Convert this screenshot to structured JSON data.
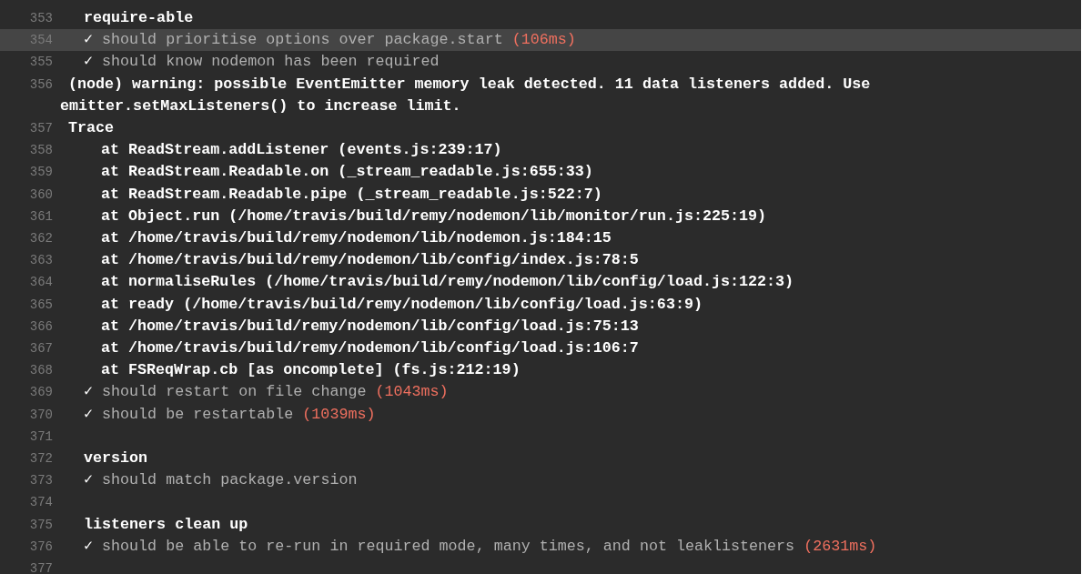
{
  "log": {
    "lines": [
      {
        "number": "353",
        "kind": "heading",
        "text": "require-able",
        "selected": false
      },
      {
        "number": "354",
        "kind": "pass",
        "mark": "✓",
        "text": "should prioritise options over package.start",
        "duration": "(106ms)",
        "selected": true
      },
      {
        "number": "355",
        "kind": "pass",
        "mark": "✓",
        "text": "should know nodemon has been required",
        "selected": false
      },
      {
        "number": "356",
        "kind": "output",
        "text": "(node) warning: possible EventEmitter memory leak detected. 11 data listeners added. Use emitter.setMaxListeners() to increase limit.",
        "selected": false
      },
      {
        "number": "357",
        "kind": "output",
        "text": "Trace",
        "selected": false
      },
      {
        "number": "358",
        "kind": "stack",
        "text": "at ReadStream.addListener (events.js:239:17)",
        "selected": false
      },
      {
        "number": "359",
        "kind": "stack",
        "text": "at ReadStream.Readable.on (_stream_readable.js:655:33)",
        "selected": false
      },
      {
        "number": "360",
        "kind": "stack",
        "text": "at ReadStream.Readable.pipe (_stream_readable.js:522:7)",
        "selected": false
      },
      {
        "number": "361",
        "kind": "stack",
        "text": "at Object.run (/home/travis/build/remy/nodemon/lib/monitor/run.js:225:19)",
        "selected": false
      },
      {
        "number": "362",
        "kind": "stack",
        "text": "at /home/travis/build/remy/nodemon/lib/nodemon.js:184:15",
        "selected": false
      },
      {
        "number": "363",
        "kind": "stack",
        "text": "at /home/travis/build/remy/nodemon/lib/config/index.js:78:5",
        "selected": false
      },
      {
        "number": "364",
        "kind": "stack",
        "text": "at normaliseRules (/home/travis/build/remy/nodemon/lib/config/load.js:122:3)",
        "selected": false
      },
      {
        "number": "365",
        "kind": "stack",
        "text": "at ready (/home/travis/build/remy/nodemon/lib/config/load.js:63:9)",
        "selected": false
      },
      {
        "number": "366",
        "kind": "stack",
        "text": "at /home/travis/build/remy/nodemon/lib/config/load.js:75:13",
        "selected": false
      },
      {
        "number": "367",
        "kind": "stack",
        "text": "at /home/travis/build/remy/nodemon/lib/config/load.js:106:7",
        "selected": false
      },
      {
        "number": "368",
        "kind": "stack",
        "text": "at FSReqWrap.cb [as oncomplete] (fs.js:212:19)",
        "selected": false
      },
      {
        "number": "369",
        "kind": "pass",
        "mark": "✓",
        "text": "should restart on file change",
        "duration": "(1043ms)",
        "selected": false
      },
      {
        "number": "370",
        "kind": "pass",
        "mark": "✓",
        "text": "should be restartable",
        "duration": "(1039ms)",
        "selected": false
      },
      {
        "number": "371",
        "kind": "blank",
        "selected": false
      },
      {
        "number": "372",
        "kind": "heading",
        "text": "version",
        "selected": false
      },
      {
        "number": "373",
        "kind": "pass",
        "mark": "✓",
        "text": "should match package.version",
        "selected": false
      },
      {
        "number": "374",
        "kind": "blank",
        "selected": false
      },
      {
        "number": "375",
        "kind": "heading",
        "text": "listeners clean up",
        "selected": false
      },
      {
        "number": "376",
        "kind": "pass",
        "mark": "✓",
        "text": "should be able to re-run in required mode, many times, and not leaklisteners",
        "duration": "(2631ms)",
        "selected": false
      },
      {
        "number": "377",
        "kind": "blank",
        "selected": false
      }
    ]
  }
}
